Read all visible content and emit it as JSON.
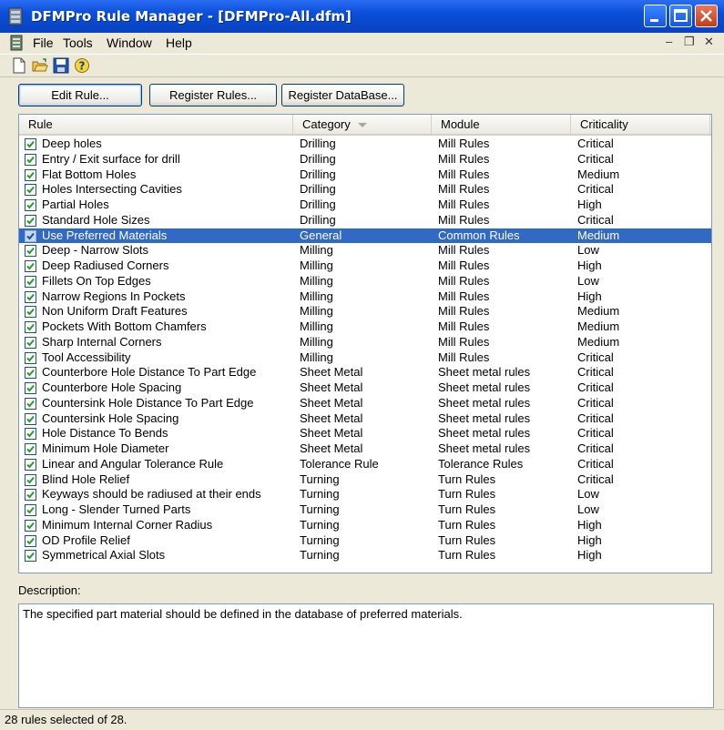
{
  "window": {
    "title": "DFMPro Rule Manager - [DFMPro-All.dfm]"
  },
  "menu": {
    "items": [
      "File",
      "Tools",
      "Window",
      "Help"
    ],
    "mdi_min": "–",
    "mdi_restore": "❐",
    "mdi_close": "✕"
  },
  "toolbar": {
    "icons": [
      "new-document-icon",
      "open-folder-icon",
      "save-disk-icon",
      "help-icon"
    ]
  },
  "buttons": {
    "edit_rule": "Edit Rule...",
    "register_rules": "Register Rules...",
    "register_database": "Register DataBase..."
  },
  "table": {
    "columns": [
      "Rule",
      "Category",
      "Module",
      "Criticality"
    ],
    "sorted_column": "Category",
    "rows": [
      {
        "rule": "Deep holes",
        "category": "Drilling",
        "module": "Mill Rules",
        "criticality": "Critical",
        "checked": true
      },
      {
        "rule": "Entry / Exit surface for drill",
        "category": "Drilling",
        "module": "Mill Rules",
        "criticality": "Critical",
        "checked": true
      },
      {
        "rule": "Flat Bottom Holes",
        "category": "Drilling",
        "module": "Mill Rules",
        "criticality": "Medium",
        "checked": true
      },
      {
        "rule": "Holes Intersecting Cavities",
        "category": "Drilling",
        "module": "Mill Rules",
        "criticality": "Critical",
        "checked": true
      },
      {
        "rule": "Partial Holes",
        "category": "Drilling",
        "module": "Mill Rules",
        "criticality": "High",
        "checked": true
      },
      {
        "rule": "Standard Hole Sizes",
        "category": "Drilling",
        "module": "Mill Rules",
        "criticality": "Critical",
        "checked": true
      },
      {
        "rule": "Use Preferred Materials",
        "category": "General",
        "module": "Common Rules",
        "criticality": "Medium",
        "checked": true,
        "selected": true
      },
      {
        "rule": "Deep - Narrow Slots",
        "category": "Milling",
        "module": "Mill Rules",
        "criticality": "Low",
        "checked": true
      },
      {
        "rule": "Deep Radiused Corners",
        "category": "Milling",
        "module": "Mill Rules",
        "criticality": "High",
        "checked": true
      },
      {
        "rule": "Fillets On Top Edges",
        "category": "Milling",
        "module": "Mill Rules",
        "criticality": "Low",
        "checked": true
      },
      {
        "rule": "Narrow Regions In Pockets",
        "category": "Milling",
        "module": "Mill Rules",
        "criticality": "High",
        "checked": true
      },
      {
        "rule": "Non Uniform Draft Features",
        "category": "Milling",
        "module": "Mill Rules",
        "criticality": "Medium",
        "checked": true
      },
      {
        "rule": "Pockets With Bottom Chamfers",
        "category": "Milling",
        "module": "Mill Rules",
        "criticality": "Medium",
        "checked": true
      },
      {
        "rule": "Sharp Internal Corners",
        "category": "Milling",
        "module": "Mill Rules",
        "criticality": "Medium",
        "checked": true
      },
      {
        "rule": "Tool Accessibility",
        "category": "Milling",
        "module": "Mill Rules",
        "criticality": "Critical",
        "checked": true
      },
      {
        "rule": "Counterbore Hole Distance To Part Edge",
        "category": "Sheet Metal",
        "module": "Sheet metal rules",
        "criticality": "Critical",
        "checked": true
      },
      {
        "rule": "Counterbore Hole Spacing",
        "category": "Sheet Metal",
        "module": "Sheet metal rules",
        "criticality": "Critical",
        "checked": true
      },
      {
        "rule": "Countersink Hole Distance To Part Edge",
        "category": "Sheet Metal",
        "module": "Sheet metal rules",
        "criticality": "Critical",
        "checked": true
      },
      {
        "rule": "Countersink Hole Spacing",
        "category": "Sheet Metal",
        "module": "Sheet metal rules",
        "criticality": "Critical",
        "checked": true
      },
      {
        "rule": "Hole Distance To Bends",
        "category": "Sheet Metal",
        "module": "Sheet metal rules",
        "criticality": "Critical",
        "checked": true
      },
      {
        "rule": "Minimum Hole Diameter",
        "category": "Sheet Metal",
        "module": "Sheet metal rules",
        "criticality": "Critical",
        "checked": true
      },
      {
        "rule": "Linear and Angular Tolerance Rule",
        "category": "Tolerance Rule",
        "module": "Tolerance Rules",
        "criticality": "Critical",
        "checked": true
      },
      {
        "rule": "Blind Hole Relief",
        "category": "Turning",
        "module": "Turn Rules",
        "criticality": "Critical",
        "checked": true
      },
      {
        "rule": "Keyways should be radiused at their ends",
        "category": "Turning",
        "module": "Turn Rules",
        "criticality": "Low",
        "checked": true
      },
      {
        "rule": "Long - Slender Turned Parts",
        "category": "Turning",
        "module": "Turn Rules",
        "criticality": "Low",
        "checked": true
      },
      {
        "rule": "Minimum Internal Corner Radius",
        "category": "Turning",
        "module": "Turn Rules",
        "criticality": "High",
        "checked": true
      },
      {
        "rule": "OD Profile Relief",
        "category": "Turning",
        "module": "Turn Rules",
        "criticality": "High",
        "checked": true
      },
      {
        "rule": "Symmetrical Axial Slots",
        "category": "Turning",
        "module": "Turn Rules",
        "criticality": "High",
        "checked": true
      }
    ]
  },
  "description": {
    "label": "Description:",
    "text": "The specified part material should be defined in the database of preferred materials."
  },
  "status": {
    "text": "28 rules selected of 28."
  },
  "colors": {
    "titlebar": "#0a4fd8",
    "selection": "#316ac5",
    "window_bg": "#ece9d8",
    "close_button": "#c23b1c"
  }
}
